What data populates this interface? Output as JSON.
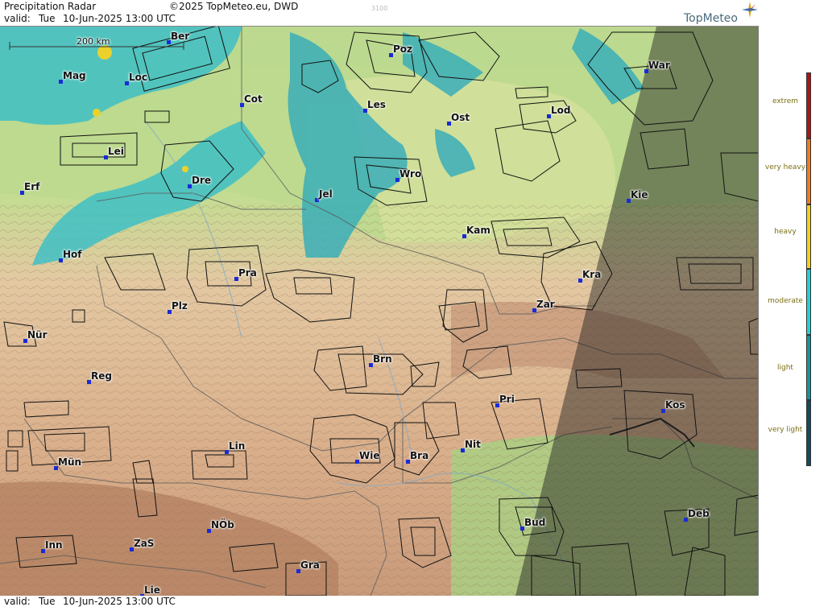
{
  "header": {
    "title": "Precipitation Radar",
    "copyright": "©2025 TopMeteo.eu, DWD",
    "valid_label": "valid:",
    "valid_day": "Tue",
    "valid_date": "10-Jun-2025 13:00 UTC",
    "faint_code": "3100"
  },
  "logo": {
    "text": "TopMeteo"
  },
  "footer": {
    "valid_label": "valid:",
    "valid_day": "Tue",
    "valid_date": "10-Jun-2025 13:00 UTC"
  },
  "map": {
    "scale_label": "200 km",
    "cities": [
      {
        "name": "Ber"
      },
      {
        "name": "Poz"
      },
      {
        "name": "War"
      },
      {
        "name": "Mag"
      },
      {
        "name": "Loc"
      },
      {
        "name": "Cot"
      },
      {
        "name": "Les"
      },
      {
        "name": "Ost"
      },
      {
        "name": "Lod"
      },
      {
        "name": "Lei"
      },
      {
        "name": "Dre"
      },
      {
        "name": "Wro"
      },
      {
        "name": "Erf"
      },
      {
        "name": "Jel"
      },
      {
        "name": "Kie"
      },
      {
        "name": "Kam"
      },
      {
        "name": "Hof"
      },
      {
        "name": "Pra"
      },
      {
        "name": "Kra"
      },
      {
        "name": "Plz"
      },
      {
        "name": "Zar"
      },
      {
        "name": "Nür"
      },
      {
        "name": "Brn"
      },
      {
        "name": "Reg"
      },
      {
        "name": "Pri"
      },
      {
        "name": "Kos"
      },
      {
        "name": "Nit"
      },
      {
        "name": "Lin"
      },
      {
        "name": "Wie"
      },
      {
        "name": "Bra"
      },
      {
        "name": "Mün"
      },
      {
        "name": "Bud"
      },
      {
        "name": "Deb"
      },
      {
        "name": "NÖb"
      },
      {
        "name": "Inn"
      },
      {
        "name": "ZaS"
      },
      {
        "name": "Gra"
      },
      {
        "name": "Lie"
      }
    ]
  },
  "legend": {
    "items": [
      {
        "label": "extrem",
        "color": "#b01313"
      },
      {
        "label": "very heavy",
        "color": "#f07c1c"
      },
      {
        "label": "heavy",
        "color": "#f4d01a"
      },
      {
        "label": "moderate",
        "color": "#1ed2d8"
      },
      {
        "label": "light",
        "color": "#16939c"
      },
      {
        "label": "very light",
        "color": "#124b5e"
      }
    ]
  }
}
